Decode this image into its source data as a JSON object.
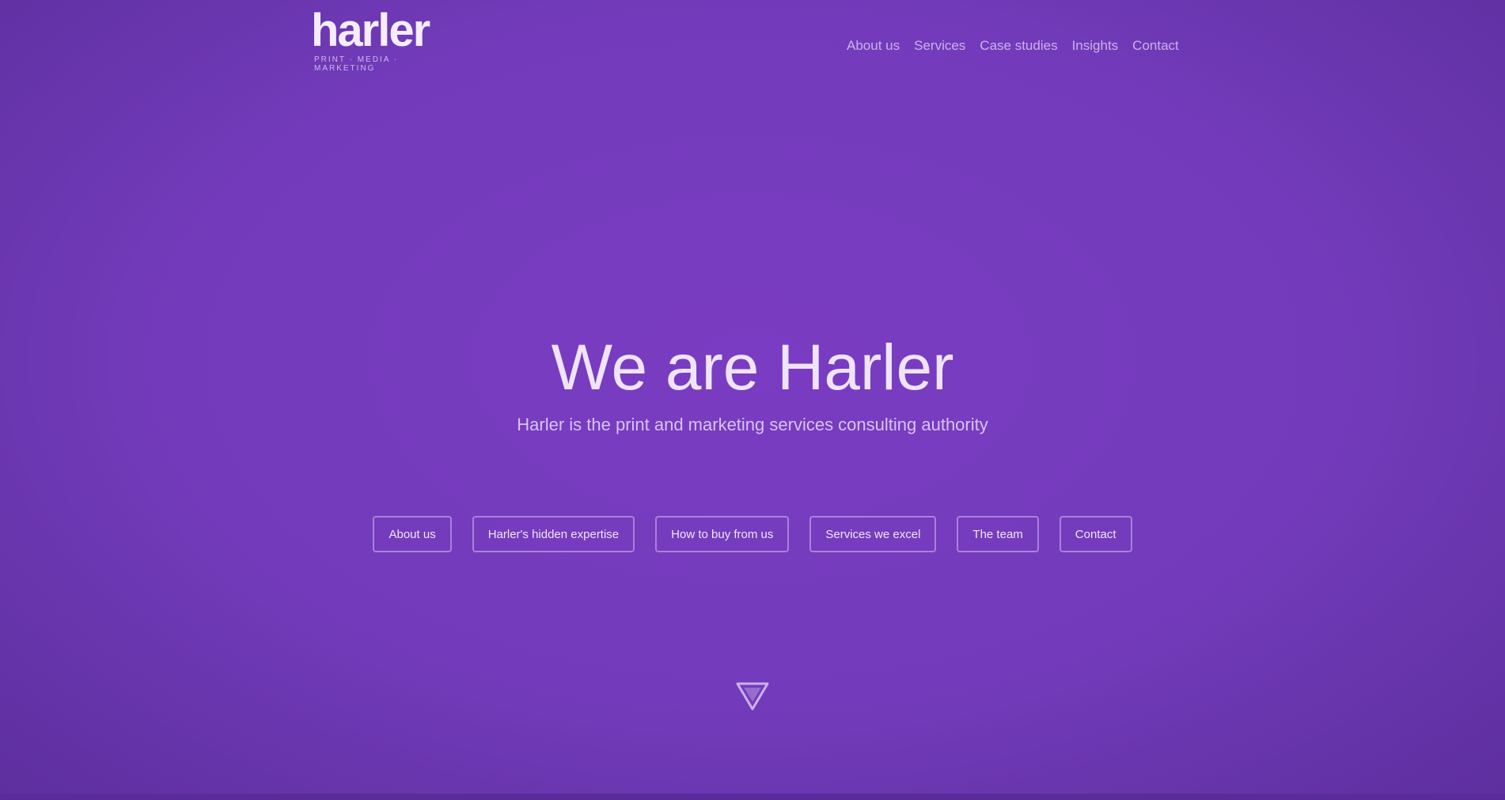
{
  "header": {
    "logo_text": "harler",
    "logo_tagline": "PRINT · MEDIA · MARKETING",
    "nav": [
      {
        "label": "About us"
      },
      {
        "label": "Services"
      },
      {
        "label": "Case studies"
      },
      {
        "label": "Insights"
      },
      {
        "label": "Contact"
      }
    ]
  },
  "hero": {
    "title": "We are Harler",
    "subtitle": "Harler is the print and marketing services consulting authority",
    "buttons": [
      {
        "label": "About us"
      },
      {
        "label": "Harler's hidden expertise"
      },
      {
        "label": "How to buy from us"
      },
      {
        "label": "Services we excel"
      },
      {
        "label": "The team"
      },
      {
        "label": "Contact"
      }
    ],
    "scroll_icon": "chevron-down-triangle-icon"
  },
  "colors": {
    "background": "#733bbb",
    "text": "#ffffff",
    "button_border": "#e6d7fa"
  }
}
